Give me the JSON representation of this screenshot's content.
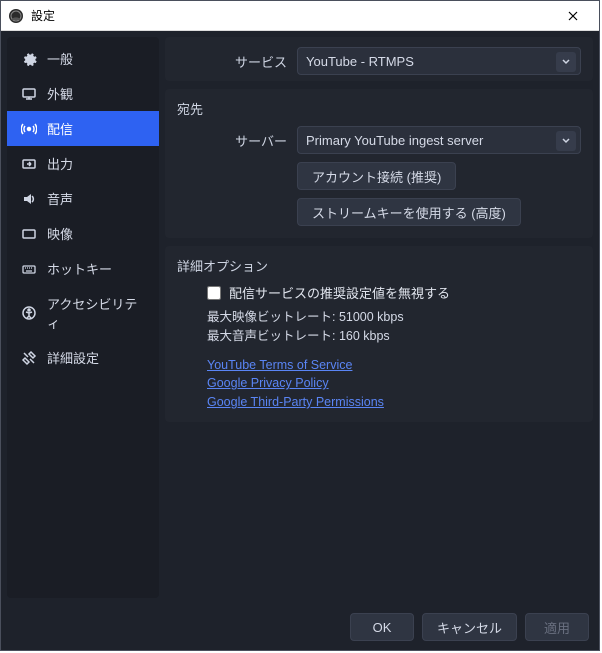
{
  "window": {
    "title": "設定"
  },
  "sidebar": {
    "items": [
      {
        "label": "一般"
      },
      {
        "label": "外観"
      },
      {
        "label": "配信"
      },
      {
        "label": "出力"
      },
      {
        "label": "音声"
      },
      {
        "label": "映像"
      },
      {
        "label": "ホットキー"
      },
      {
        "label": "アクセシビリティ"
      },
      {
        "label": "詳細設定"
      }
    ]
  },
  "service": {
    "label": "サービス",
    "value": "YouTube - RTMPS"
  },
  "destination": {
    "title": "宛先",
    "server_label": "サーバー",
    "server_value": "Primary YouTube ingest server",
    "connect_btn": "アカウント接続 (推奨)",
    "streamkey_btn": "ストリームキーを使用する (高度)"
  },
  "advanced": {
    "title": "詳細オプション",
    "ignore_label": "配信サービスの推奨設定値を無視する",
    "max_video": "最大映像ビットレート: 51000 kbps",
    "max_audio": "最大音声ビットレート: 160 kbps",
    "links": {
      "tos": "YouTube Terms of Service",
      "privacy": "Google Privacy Policy",
      "thirdparty": "Google Third-Party Permissions"
    }
  },
  "footer": {
    "ok": "OK",
    "cancel": "キャンセル",
    "apply": "適用"
  }
}
